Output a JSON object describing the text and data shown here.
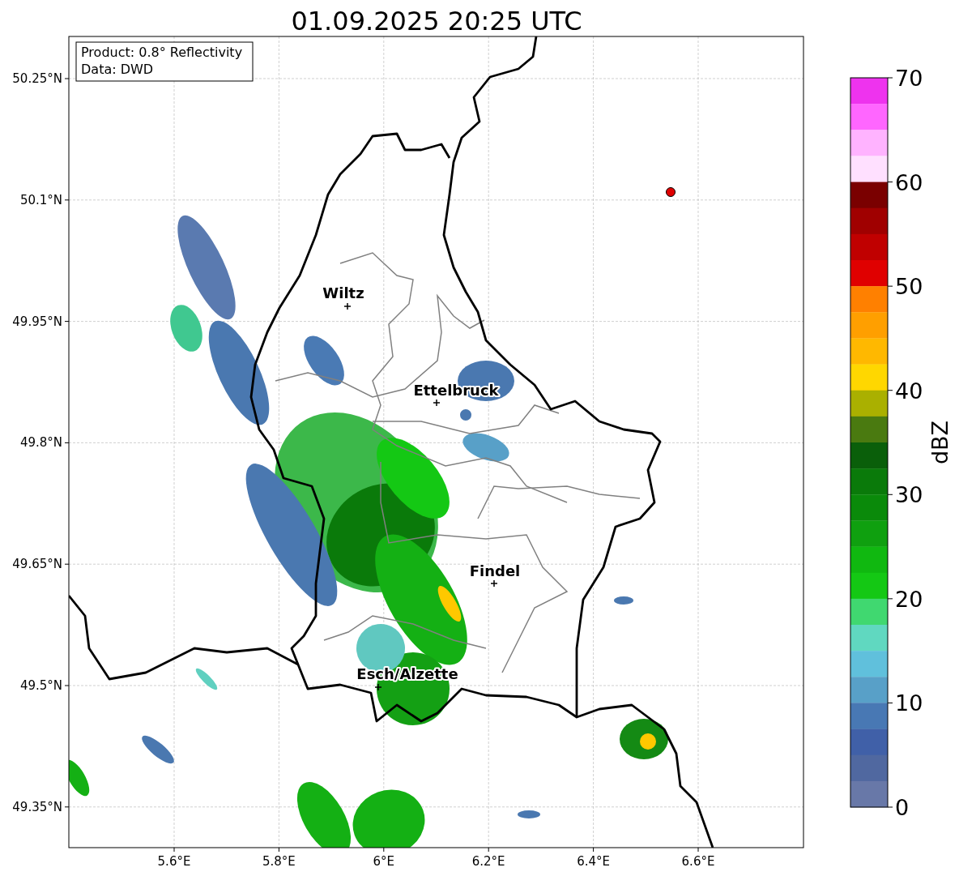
{
  "title": "01.09.2025 20:25 UTC",
  "info_box": [
    "Product: 0.8° Reflectivity",
    "Data: DWD"
  ],
  "x_ticks": [
    "5.6°E",
    "5.8°E",
    "6°E",
    "6.2°E",
    "6.4°E",
    "6.6°E"
  ],
  "y_ticks": [
    "50.25°N",
    "50.1°N",
    "49.95°N",
    "49.8°N",
    "49.65°N",
    "49.5°N",
    "49.35°N"
  ],
  "cities": [
    {
      "name": "Wiltz"
    },
    {
      "name": "Ettelbruck"
    },
    {
      "name": "Findel"
    },
    {
      "name": "Esch/Alzette"
    }
  ],
  "colorbar": {
    "label": "dBZ",
    "ticks": [
      "70",
      "60",
      "50",
      "40",
      "30",
      "20",
      "10",
      "0"
    ],
    "bands": [
      {
        "color": "#ee33ee"
      },
      {
        "color": "#ff66ff"
      },
      {
        "color": "#ffb3ff"
      },
      {
        "color": "#ffe0ff"
      },
      {
        "color": "#7a0000"
      },
      {
        "color": "#a00000"
      },
      {
        "color": "#c00000"
      },
      {
        "color": "#e00000"
      },
      {
        "color": "#ff8000"
      },
      {
        "color": "#ff9f00"
      },
      {
        "color": "#ffb800"
      },
      {
        "color": "#ffd700"
      },
      {
        "color": "#aab000"
      },
      {
        "color": "#4a7a10"
      },
      {
        "color": "#0a5f0a"
      },
      {
        "color": "#0a7a0a"
      },
      {
        "color": "#0a8a0a"
      },
      {
        "color": "#0fa00f"
      },
      {
        "color": "#10b810"
      },
      {
        "color": "#14c814"
      },
      {
        "color": "#40d870"
      },
      {
        "color": "#60d8c0"
      },
      {
        "color": "#60c0dc"
      },
      {
        "color": "#58a0c8"
      },
      {
        "color": "#4878b4"
      },
      {
        "color": "#4060a8"
      },
      {
        "color": "#5068a0"
      },
      {
        "color": "#6878a8"
      }
    ]
  }
}
